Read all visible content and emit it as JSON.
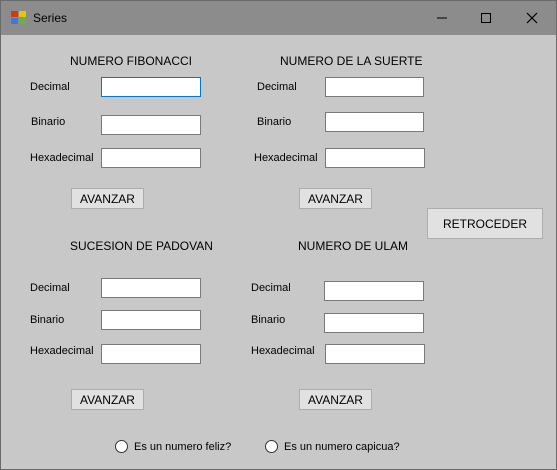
{
  "window": {
    "title": "Series",
    "minimize_icon": "minimize-icon",
    "maximize_icon": "maximize-icon",
    "close_icon": "close-icon"
  },
  "fibonacci": {
    "header": "NUMERO FIBONACCI",
    "decimal_label": "Decimal",
    "binario_label": "Binario",
    "hexadecimal_label": "Hexadecimal",
    "decimal_value": "",
    "binario_value": "",
    "hexadecimal_value": "",
    "button_label": "AVANZAR"
  },
  "suerte": {
    "header": "NUMERO DE LA SUERTE",
    "decimal_label": "Decimal",
    "binario_label": "Binario",
    "hexadecimal_label": "Hexadecimal",
    "decimal_value": "",
    "binario_value": "",
    "hexadecimal_value": "",
    "button_label": "AVANZAR"
  },
  "retroceder_label": "RETROCEDER",
  "padovan": {
    "header": "SUCESION DE PADOVAN",
    "decimal_label": "Decimal",
    "binario_label": "Binario",
    "hexadecimal_label": "Hexadecimal",
    "decimal_value": "",
    "binario_value": "",
    "hexadecimal_value": "",
    "button_label": "AVANZAR"
  },
  "ulam": {
    "header": "NUMERO DE ULAM",
    "decimal_label": "Decimal",
    "binario_label": "Binario",
    "hexadecimal_label": "Hexadecimal",
    "decimal_value": "",
    "binario_value": "",
    "hexadecimal_value": "",
    "button_label": "AVANZAR"
  },
  "radios": {
    "feliz_label": "Es un numero feliz?",
    "capicua_label": "Es un numero capicua?"
  },
  "colors": {
    "window_bg": "#c8c8c8",
    "titlebar_bg": "#8c8c8c",
    "focus_border": "#0078d7"
  }
}
